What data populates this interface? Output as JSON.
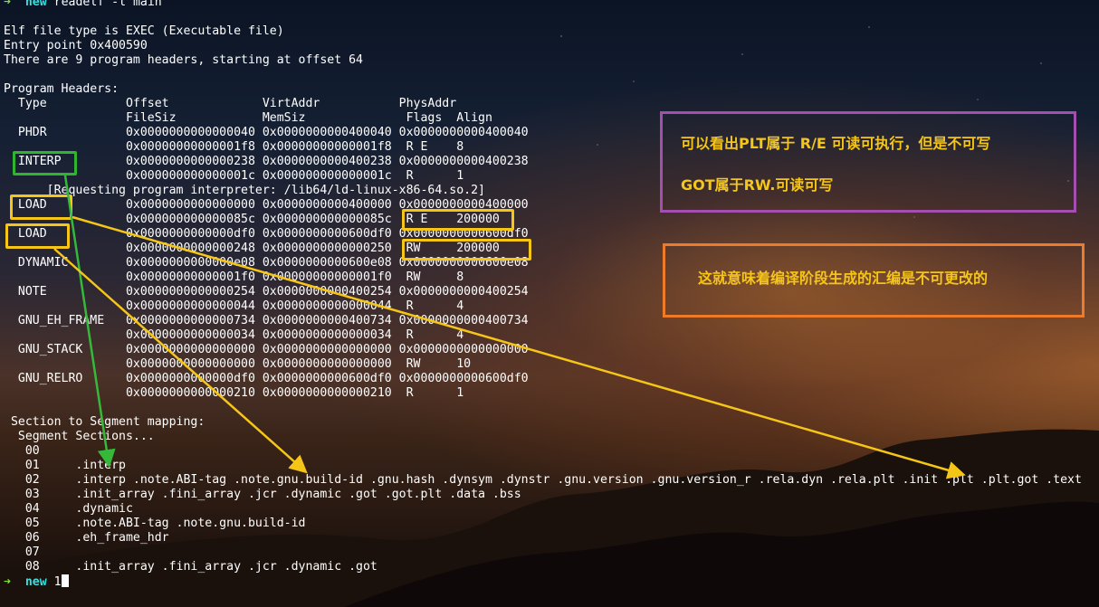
{
  "terminal": {
    "prompt_arrow": "➜",
    "prompt_dir": "new",
    "command": "readelf -l main",
    "lines": [
      "",
      "Elf file type is EXEC (Executable file)",
      "Entry point 0x400590",
      "There are 9 program headers, starting at offset 64",
      "",
      "Program Headers:",
      "  Type           Offset             VirtAddr           PhysAddr",
      "                 FileSiz            MemSiz              Flags  Align",
      "  PHDR           0x0000000000000040 0x0000000000400040 0x0000000000400040",
      "                 0x00000000000001f8 0x00000000000001f8  R E    8",
      "  INTERP         0x0000000000000238 0x0000000000400238 0x0000000000400238",
      "                 0x000000000000001c 0x000000000000001c  R      1",
      "      [Requesting program interpreter: /lib64/ld-linux-x86-64.so.2]",
      "  LOAD           0x0000000000000000 0x0000000000400000 0x0000000000400000",
      "                 0x000000000000085c 0x000000000000085c  R E    200000",
      "  LOAD           0x0000000000000df0 0x0000000000600df0 0x0000000000600df0",
      "                 0x0000000000000248 0x0000000000000250  RW     200000",
      "  DYNAMIC        0x0000000000000e08 0x0000000000600e08 0x0000000000600e08",
      "                 0x00000000000001f0 0x00000000000001f0  RW     8",
      "  NOTE           0x0000000000000254 0x0000000000400254 0x0000000000400254",
      "                 0x0000000000000044 0x0000000000000044  R      4",
      "  GNU_EH_FRAME   0x0000000000000734 0x0000000000400734 0x0000000000400734",
      "                 0x0000000000000034 0x0000000000000034  R      4",
      "  GNU_STACK      0x0000000000000000 0x0000000000000000 0x0000000000000000",
      "                 0x0000000000000000 0x0000000000000000  RW     10",
      "  GNU_RELRO      0x0000000000000df0 0x0000000000600df0 0x0000000000600df0",
      "                 0x0000000000000210 0x0000000000000210  R      1",
      "",
      " Section to Segment mapping:",
      "  Segment Sections...",
      "   00     ",
      "   01     .interp ",
      "   02     .interp .note.ABI-tag .note.gnu.build-id .gnu.hash .dynsym .dynstr .gnu.version .gnu.version_r .rela.dyn .rela.plt .init .plt .plt.got .text",
      "   03     .init_array .fini_array .jcr .dynamic .got .got.plt .data .bss ",
      "   04     .dynamic ",
      "   05     .note.ABI-tag .note.gnu.build-id ",
      "   06     .eh_frame_hdr ",
      "   07     ",
      "   08     .init_array .fini_array .jcr .dynamic .got "
    ],
    "last_prompt_input": "1"
  },
  "annotations": {
    "note1_line1": "可以看出PLT属于 R/E 可读可执行，但是不可写",
    "note1_line2": "GOT属于RW.可读可写",
    "note2": "这就意味着编译阶段生成的汇编是不可更改的"
  },
  "colors": {
    "interp_box": "#2fb52f",
    "load_box": "#f5c518",
    "note1_border": "#a44fb0",
    "note2_border": "#ee7b2a",
    "note_text": "#f5c518",
    "arrow_yellow": "#f5c518",
    "arrow_green": "#36b83a"
  }
}
